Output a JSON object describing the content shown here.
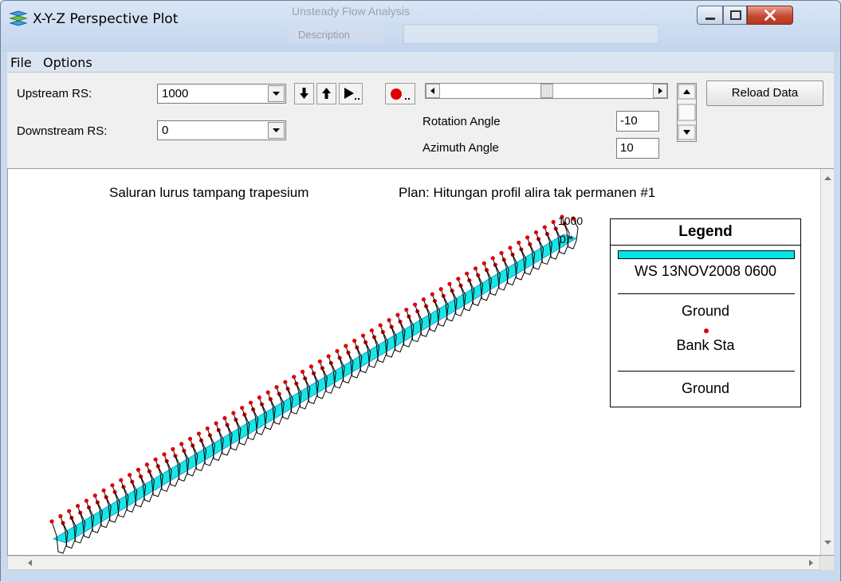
{
  "window": {
    "title": "X-Y-Z Perspective Plot",
    "background_text": [
      "Unsteady Flow Analysis",
      "Description"
    ]
  },
  "menu": {
    "items": [
      "File",
      "Options"
    ]
  },
  "controls": {
    "upstream_label": "Upstream RS:",
    "upstream_value": "1000",
    "downstream_label": "Downstream RS:",
    "downstream_value": "0",
    "rotation_label": "Rotation Angle",
    "rotation_value": "-10",
    "azimuth_label": "Azimuth Angle",
    "azimuth_value": "10",
    "reload_label": "Reload Data",
    "slider_position": 0.5
  },
  "plot": {
    "title_left": "Saluran lurus tampang trapesium",
    "title_right": "Plan: Hitungan profil alira tak permanen #1",
    "label_upstream": "1000",
    "label_downstream": "0.*",
    "section_count": 60
  },
  "legend": {
    "title": "Legend",
    "items": [
      "WS 13NOV2008 0600",
      "Ground",
      "Bank Sta",
      "Ground"
    ]
  },
  "colors": {
    "water": "#00e5e5",
    "bank": "#e00000",
    "ground": "#000000",
    "channel_fill": "#1a8fd0"
  }
}
